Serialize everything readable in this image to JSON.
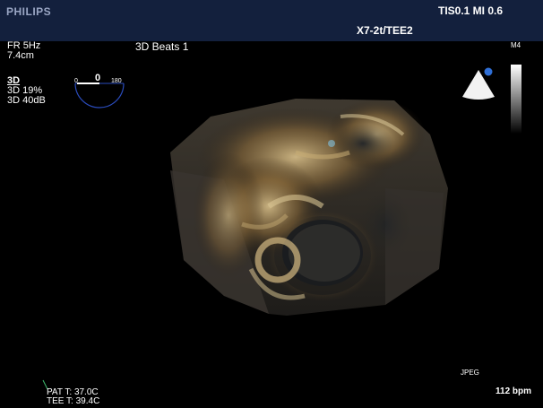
{
  "header": {
    "brand": "PHILIPS",
    "tis_mi": "TIS0.1   MI 0.6",
    "probe": "X7-2t/TEE2"
  },
  "params": {
    "fr": "FR 5Hz",
    "depth": "7.4cm",
    "mode": "3D",
    "gain": "3D 19%",
    "compress": "3D 40dB"
  },
  "angle_indicator": {
    "min": "0",
    "value": "0",
    "max": "180"
  },
  "title": "3D Beats 1",
  "scale_label": "M4",
  "footer": {
    "format": "JPEG",
    "heart_rate": "112 bpm",
    "pat_temp": "PAT T: 37.0C",
    "tee_temp": "TEE T: 39.4C"
  }
}
